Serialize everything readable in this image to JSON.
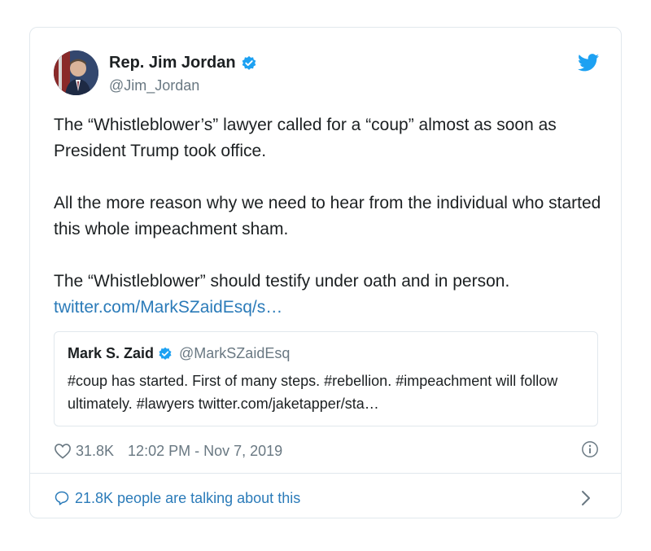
{
  "tweet": {
    "author_name": "Rep. Jim Jordan",
    "author_handle": "@Jim_Jordan",
    "paragraph1": "The “Whistleblower’s” lawyer called for a “coup” almost as soon as President Trump took office.",
    "paragraph2": "All the more reason why we need to hear from the individual who started this whole impeachment sham.",
    "paragraph3": "The “Whistleblower” should testify under oath and in person.",
    "link": "twitter.com/MarkSZaidEsq/s…",
    "likes": "31.8K",
    "timestamp": "12:02 PM - Nov 7, 2019",
    "talking": "21.8K people are talking about this"
  },
  "quoted": {
    "name": "Mark S. Zaid",
    "handle": "@MarkSZaidEsq",
    "text": "#coup has started. First of many steps. #rebellion. #impeachment will follow ultimately. #lawyers twitter.com/jaketapper/sta…"
  },
  "colors": {
    "link": "#2b7bb9",
    "verified": "#1da1f2",
    "muted": "#697882",
    "border": "#e1e8ed"
  }
}
